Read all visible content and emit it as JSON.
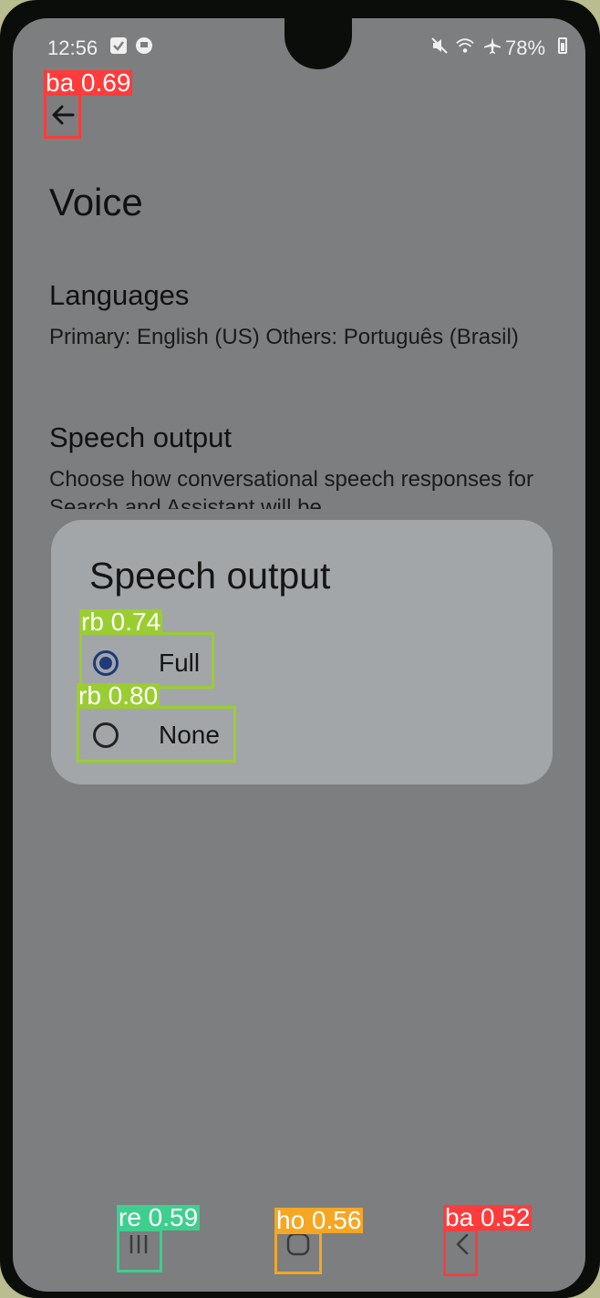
{
  "status_bar": {
    "time": "12:56",
    "battery": "78%"
  },
  "page": {
    "title": "Voice"
  },
  "settings": [
    {
      "title": "Languages",
      "subtitle": "Primary: English (US) Others: Português (Brasil)"
    },
    {
      "title": "Speech output",
      "subtitle": "Choose how conversational speech responses for Search and Assistant will be"
    }
  ],
  "dialog": {
    "title": "Speech output",
    "options": [
      {
        "label": "Full",
        "selected": true
      },
      {
        "label": "None",
        "selected": false
      }
    ]
  },
  "detections": [
    {
      "label": "ba 0.69",
      "color": "#ff3b3b"
    },
    {
      "label": "rb 0.74",
      "color": "#9acd32"
    },
    {
      "label": "rb 0.80",
      "color": "#9acd32"
    },
    {
      "label": "re 0.59",
      "color": "#3ecf8e"
    },
    {
      "label": "ho 0.56",
      "color": "#f5a623"
    },
    {
      "label": "ba 0.52",
      "color": "#ff3b3b"
    }
  ],
  "icons": {
    "back": "back-arrow-icon",
    "recents": "recents-icon",
    "home": "home-icon",
    "nav_back": "nav-back-icon"
  }
}
